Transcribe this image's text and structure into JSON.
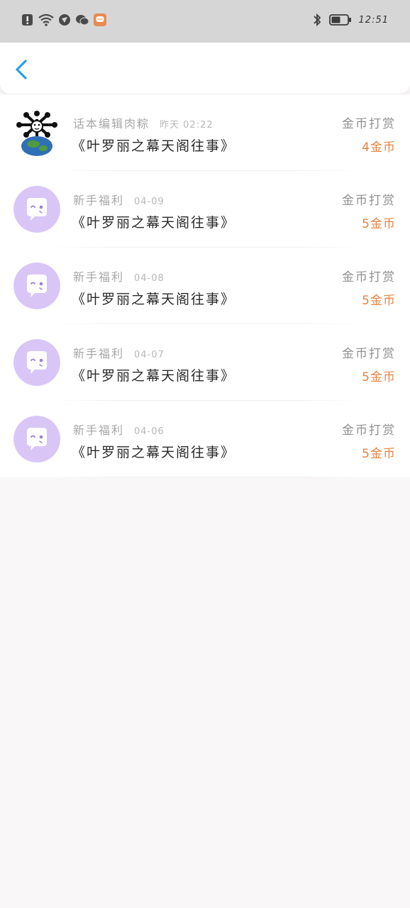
{
  "status_bar": {
    "time": "12:51",
    "left_icons": [
      "alert-icon",
      "wifi-icon",
      "vpn-icon",
      "wechat-icon",
      "message-app-icon"
    ],
    "right_icons": [
      "bluetooth-icon",
      "battery-icon"
    ]
  },
  "nav": {
    "back_icon": "chevron-left-icon",
    "accent": "#2a9fe3"
  },
  "rewards": [
    {
      "sender": "话本编辑肉粽",
      "date": "昨天 02:22",
      "book": "《叶罗丽之幕天阁往事》",
      "type": "金币打赏",
      "amount": "4金币",
      "avatar": "custom-avatar"
    },
    {
      "sender": "新手福利",
      "date": "04-09",
      "book": "《叶罗丽之幕天阁往事》",
      "type": "金币打赏",
      "amount": "5金币",
      "avatar": "chat-bubble-avatar"
    },
    {
      "sender": "新手福利",
      "date": "04-08",
      "book": "《叶罗丽之幕天阁往事》",
      "type": "金币打赏",
      "amount": "5金币",
      "avatar": "chat-bubble-avatar"
    },
    {
      "sender": "新手福利",
      "date": "04-07",
      "book": "《叶罗丽之幕天阁往事》",
      "type": "金币打赏",
      "amount": "5金币",
      "avatar": "chat-bubble-avatar"
    },
    {
      "sender": "新手福利",
      "date": "04-06",
      "book": "《叶罗丽之幕天阁往事》",
      "type": "金币打赏",
      "amount": "5金币",
      "avatar": "chat-bubble-avatar"
    }
  ],
  "colors": {
    "amount": "#e9823e",
    "avatar_bg": "#d9c6f7"
  }
}
